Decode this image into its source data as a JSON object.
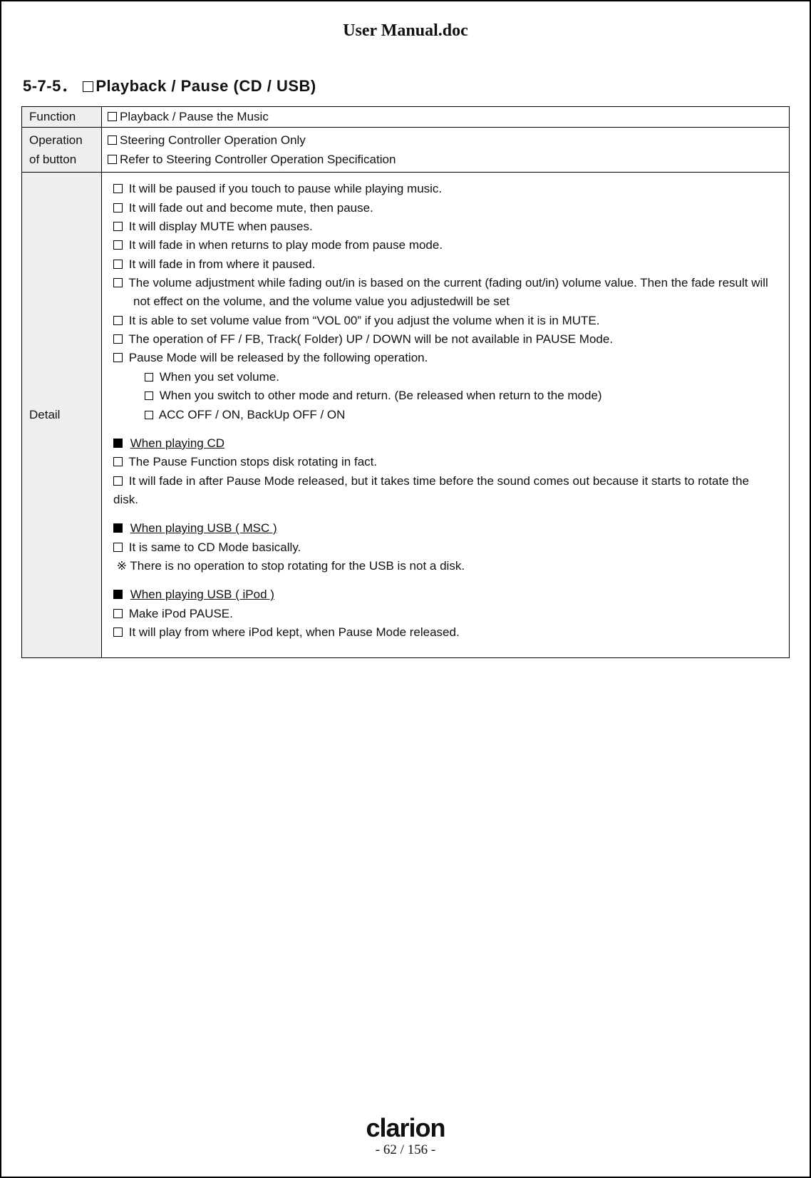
{
  "doc_title": "User Manual.doc",
  "section_number": "5-7-5．",
  "section_title": "Playback / Pause (CD / USB)",
  "rows": {
    "function_label": "Function",
    "function_value": "Playback / Pause the Music",
    "operation_label_1": "Operation",
    "operation_label_2": "of button",
    "operation_value_1": "Steering Controller Operation Only",
    "operation_value_2": "Refer to Steering Controller Operation Specification",
    "detail_label": "Detail"
  },
  "detail": {
    "b1": "It will be paused if you touch to pause while playing music.",
    "b2": "It will fade out and become mute, then pause.",
    "b3": "It will display MUTE when pauses.",
    "b4": "It will fade in when returns to play mode from pause mode.",
    "b5": "It will fade in from where it paused.",
    "b6a": "The volume adjustment while fading out/in is based on the current (fading out/in) volume value. Then the fade result will",
    "b6b": "not effect on the volume, and the volume value you adjustedwill be set",
    "b7": "It is able to set volume value from “VOL 00” if you adjust the volume when it is in MUTE.",
    "b8": "The operation of FF / FB, Track( Folder) UP / DOWN will be not available in PAUSE Mode.",
    "b9": "Pause Mode will be released by the following operation.",
    "b9_1": "When you set volume.",
    "b9_2": "When you switch to other mode and return. (Be released when return to the mode)",
    "b9_3": "ACC OFF / ON, BackUp OFF / ON",
    "h_cd": "When playing CD",
    "cd_1": "The Pause Function stops disk rotating in fact.",
    "cd_2a": "It will fade in after Pause Mode released, but it takes time before the sound comes out because it starts to rotate the",
    "cd_2b": "disk.",
    "h_msc": "When playing USB ( MSC )",
    "msc_1": "It is same to CD Mode basically.",
    "msc_note_prefix": "※",
    "msc_note": "There is no operation to stop rotating for the USB is not a disk.",
    "h_ipod": "When playing USB ( iPod )",
    "ipod_1": "Make iPod PAUSE.",
    "ipod_2": "It will play from where iPod kept, when Pause Mode released."
  },
  "footer": {
    "brand": "clarion",
    "page_current": "62",
    "page_total": "156"
  }
}
